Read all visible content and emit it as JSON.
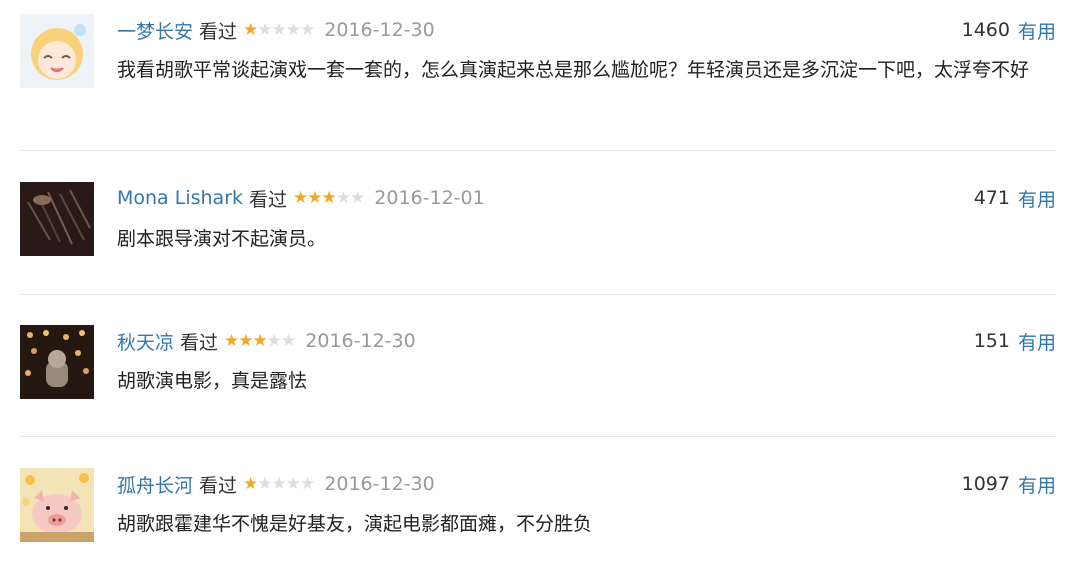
{
  "colors": {
    "link": "#3377aa",
    "star_filled": "#f5a623",
    "star_empty": "#dddddd",
    "date": "#999999",
    "divider": "#e6e6e6"
  },
  "comments": [
    {
      "author": "一梦长安",
      "status": "看过",
      "rating": 1,
      "date": "2016-12-30",
      "votes": "1460",
      "useful_label": "有用",
      "text": "我看胡歌平常谈起演戏一套一套的，怎么真演起来总是那么尴尬呢？年轻演员还是多沉淀一下吧，太浮夸不好"
    },
    {
      "author": "Mona Lishark",
      "status": "看过",
      "rating": 3,
      "date": "2016-12-01",
      "votes": "471",
      "useful_label": "有用",
      "text": "剧本跟导演对不起演员。"
    },
    {
      "author": "秋天凉",
      "status": "看过",
      "rating": 3,
      "date": "2016-12-30",
      "votes": "151",
      "useful_label": "有用",
      "text": "胡歌演电影，真是露怯"
    },
    {
      "author": "孤舟长河",
      "status": "看过",
      "rating": 1,
      "date": "2016-12-30",
      "votes": "1097",
      "useful_label": "有用",
      "text": "胡歌跟霍建华不愧是好基友，演起电影都面瘫，不分胜负"
    }
  ]
}
